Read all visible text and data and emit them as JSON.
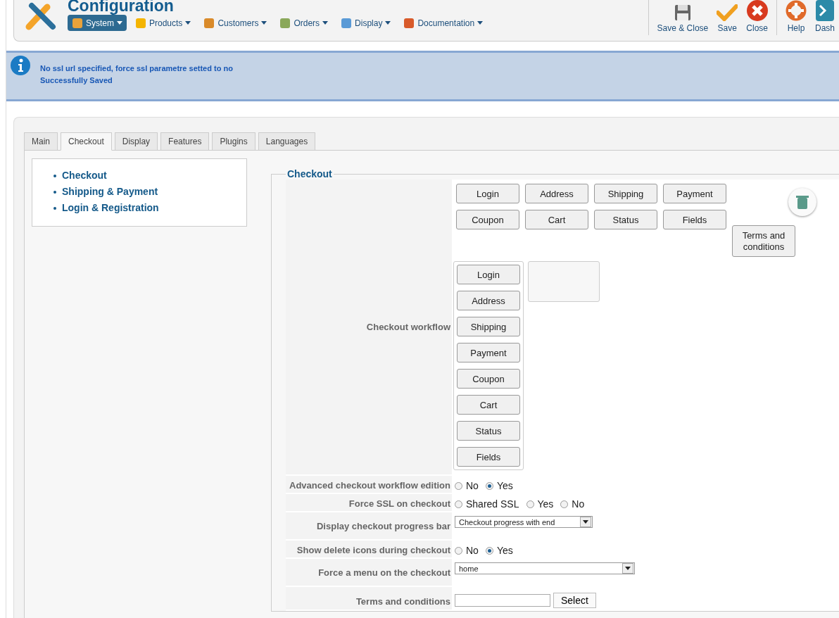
{
  "header": {
    "title": "Configuration",
    "nav": [
      {
        "label": "System",
        "selected": true
      },
      {
        "label": "Products",
        "selected": false
      },
      {
        "label": "Customers",
        "selected": false
      },
      {
        "label": "Orders",
        "selected": false
      },
      {
        "label": "Display",
        "selected": false
      },
      {
        "label": "Documentation",
        "selected": false
      }
    ],
    "toolbar": [
      {
        "label": "Save & Close",
        "kind": "save"
      },
      {
        "label": "Save",
        "kind": "check"
      },
      {
        "label": "Close",
        "kind": "close"
      },
      {
        "label": "Help",
        "kind": "help"
      },
      {
        "label": "Dash",
        "kind": "dash"
      }
    ]
  },
  "messages": [
    "No ssl url specified, force ssl parametre setted to no",
    "Successfully Saved"
  ],
  "tabs": [
    {
      "label": "Main",
      "selected": false
    },
    {
      "label": "Checkout",
      "selected": true
    },
    {
      "label": "Display",
      "selected": false
    },
    {
      "label": "Features",
      "selected": false
    },
    {
      "label": "Plugins",
      "selected": false
    },
    {
      "label": "Languages",
      "selected": false
    }
  ],
  "subnav": [
    "Checkout",
    "Shipping & Payment",
    "Login & Registration"
  ],
  "fieldset": {
    "legend": "Checkout",
    "workflow": {
      "label": "Checkout workflow",
      "available_steps": [
        "Login",
        "Address",
        "Shipping",
        "Payment",
        "Coupon",
        "Cart",
        "Status",
        "Fields"
      ],
      "extra_step": "Terms and conditions",
      "workflow_steps": [
        "Login",
        "Address",
        "Shipping",
        "Payment",
        "Coupon",
        "Cart",
        "Status",
        "Fields"
      ]
    },
    "settings": [
      {
        "kind": "radio",
        "label": "Advanced checkout workflow edition",
        "options": [
          {
            "label": "No",
            "selected": false
          },
          {
            "label": "Yes",
            "selected": true
          }
        ]
      },
      {
        "kind": "radio",
        "label": "Force SSL on checkout",
        "options": [
          {
            "label": "Shared SSL",
            "selected": false
          },
          {
            "label": "Yes",
            "selected": false
          },
          {
            "label": "No",
            "selected": false
          }
        ]
      },
      {
        "kind": "select",
        "label": "Display checkout progress bar",
        "value": "Checkout progress with end",
        "wide": false
      },
      {
        "kind": "radio",
        "label": "Show delete icons during checkout",
        "options": [
          {
            "label": "No",
            "selected": false
          },
          {
            "label": "Yes",
            "selected": true
          }
        ]
      },
      {
        "kind": "select",
        "label": "Force a menu on the checkout",
        "value": "home",
        "wide": true
      },
      {
        "kind": "text_select",
        "label": "Terms and conditions",
        "button": "Select"
      }
    ]
  }
}
